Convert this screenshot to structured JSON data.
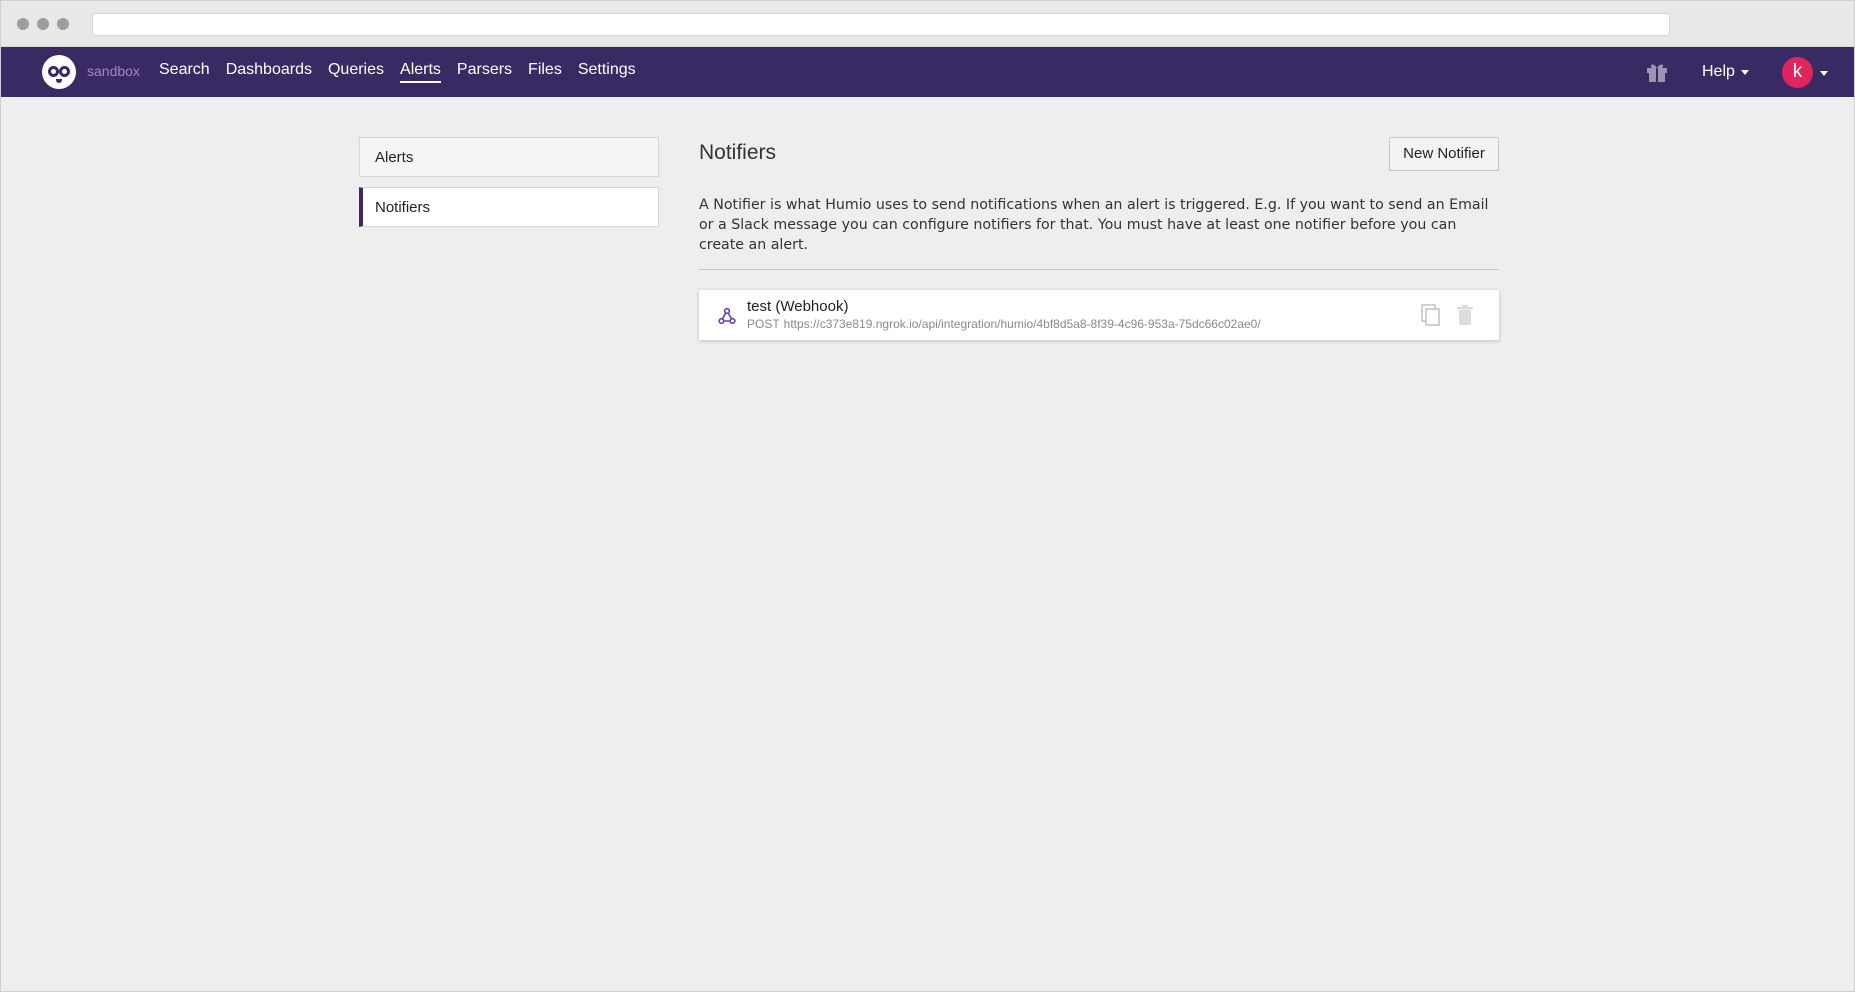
{
  "nav": {
    "repo": "sandbox",
    "links": [
      "Search",
      "Dashboards",
      "Queries",
      "Alerts",
      "Parsers",
      "Files",
      "Settings"
    ],
    "active": "Alerts",
    "help_label": "Help",
    "avatar_letter": "k",
    "avatar_color": "#e0245e",
    "brand_color": "#3a2a63"
  },
  "sidebar": {
    "items": [
      {
        "label": "Alerts"
      },
      {
        "label": "Notifiers"
      }
    ]
  },
  "main": {
    "title": "Notifiers",
    "new_button": "New Notifier",
    "description": "A Notifier is what Humio uses to send notifications when an alert is triggered. E.g. If you want to send an Email or a Slack message you can configure notifiers for that. You must have at least one notifier before you can create an alert.",
    "notifiers": [
      {
        "name": "test (Webhook)",
        "method": "POST",
        "url": "https://c373e819.ngrok.io/api/integration/humio/4bf8d5a8-8f39-4c96-953a-75dc66c02ae0/",
        "icon": "webhook-icon"
      }
    ]
  }
}
